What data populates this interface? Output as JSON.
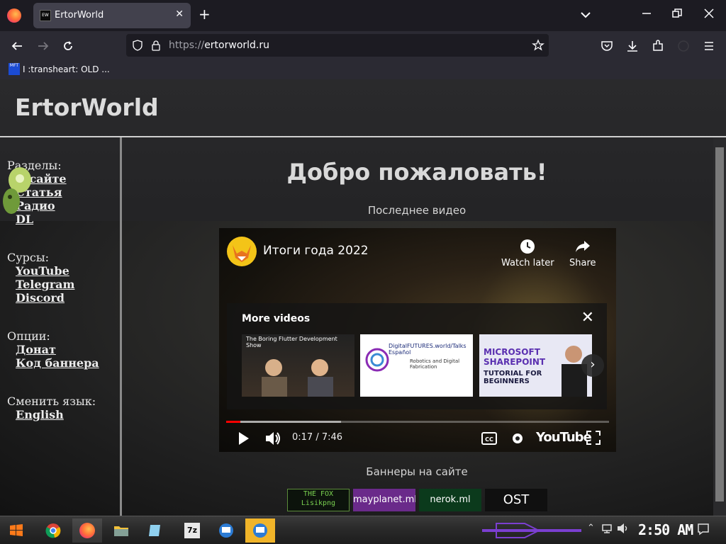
{
  "browser": {
    "tab": {
      "title": "ErtorWorld",
      "favicon_text": "EW"
    },
    "address": {
      "protocol": "https://",
      "host": "ertorworld.ru"
    },
    "bookmark": {
      "label": "I :transheart: OLD ...",
      "favicon_text": "MFT"
    }
  },
  "site": {
    "title": "ErtorWorld",
    "sidebar": {
      "sections": [
        {
          "heading": "Разделы:",
          "links": [
            "О сайте",
            "Статья",
            "Радио",
            "DL"
          ]
        },
        {
          "heading": "Сурсы:",
          "links": [
            "YouTube",
            "Telegram",
            "Discord"
          ]
        },
        {
          "heading": "Опции:",
          "links": [
            "Донат",
            "Код баннера"
          ]
        },
        {
          "heading": "Сменить язык:",
          "links": [
            "English"
          ]
        }
      ]
    },
    "main": {
      "heading": "Добро пожаловать!",
      "latest_video_label": "Последнее видео",
      "banners_label": "Баннеры на сайте",
      "banners": [
        "THE FOX Lisikpng",
        "mayplanet.ml",
        "nerok.ml",
        "OST"
      ]
    }
  },
  "video": {
    "title": "Итоги года 2022",
    "watch_later": "Watch later",
    "share": "Share",
    "more_videos": "More videos",
    "thumbs": [
      {
        "title": "The Boring Flutter Development Show"
      },
      {
        "title": "DigitalFUTURES.world/Talks Español",
        "subtitle": "Robotics and Digital Fabrication"
      },
      {
        "title": "MICROSOFT SHAREPOINT",
        "subtitle": "TUTORIAL FOR BEGINNERS"
      }
    ],
    "time": "0:17 / 7:46",
    "progress": 0.037,
    "buffered": 0.3,
    "youtube_label": "YouTube"
  },
  "taskbar": {
    "clock": "2:50 AM",
    "accent": "#7b3fd0"
  }
}
